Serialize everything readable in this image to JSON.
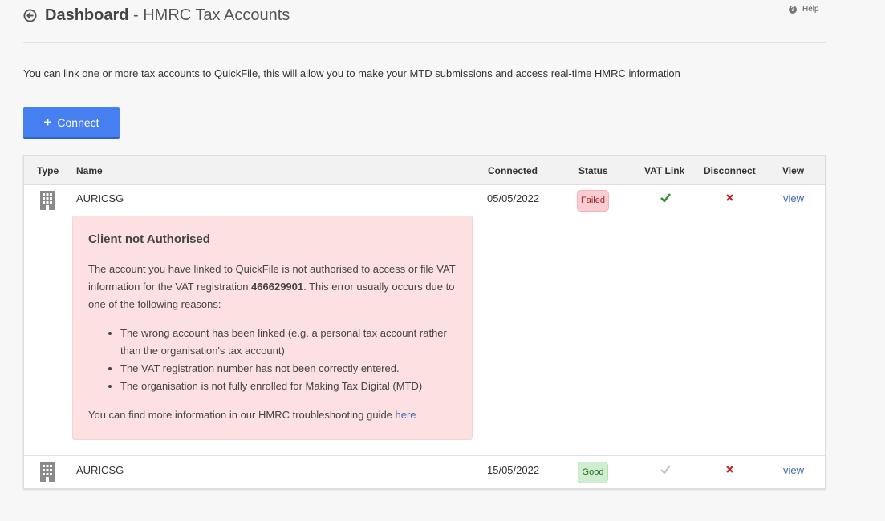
{
  "header": {
    "title_bold": "Dashboard",
    "title_rest": " - HMRC Tax Accounts",
    "help_label": "Help"
  },
  "intro_text": "You can link one or more tax accounts to QuickFile, this will allow you to make your MTD submissions and access real-time HMRC information",
  "connect_label": "Connect",
  "table": {
    "columns": [
      "Type",
      "Name",
      "Connected",
      "Status",
      "VAT Link",
      "Disconnect",
      "View"
    ],
    "rows": [
      {
        "type_icon": "building-icon",
        "name": "AURICSG",
        "connected": "05/05/2022",
        "status": "Failed",
        "vat_link": "check-green",
        "disconnect": "x",
        "view": "view"
      },
      {
        "type_icon": "building-icon",
        "name": "AURICSG",
        "connected": "15/05/2022",
        "status": "Good",
        "vat_link": "check-grey",
        "disconnect": "x",
        "view": "view"
      }
    ]
  },
  "alert": {
    "title": "Client not Authorised",
    "body_pre": "The account you have linked to QuickFile is not authorised to access or file VAT information for the VAT registration ",
    "vat_number": "466629901",
    "body_post": ". This error usually occurs due to one of the following reasons:",
    "reasons": [
      "The wrong account has been linked (e.g. a personal tax account rather than the organisation's tax account)",
      "The VAT registration number has not been correctly entered.",
      "The organisation is not fully enrolled for Making Tax Digital (MTD)"
    ],
    "footer_text": "You can find more information in our HMRC troubleshooting guide ",
    "footer_link": "here"
  },
  "colors": {
    "accent": "#4680f0",
    "failed_bg": "#f9cdd2",
    "good_bg": "#cfeecf",
    "alert_bg": "#fde0e2",
    "link": "#3a6db3"
  }
}
